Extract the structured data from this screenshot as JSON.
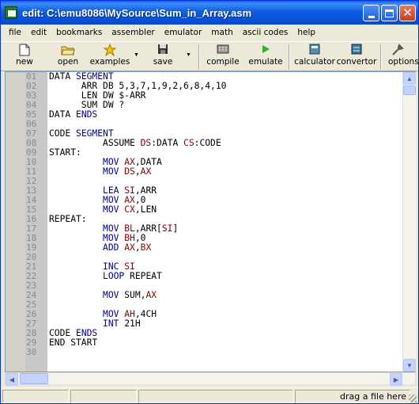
{
  "window": {
    "title": "edit: C:\\emu8086\\MySource\\Sum_in_Array.asm"
  },
  "menu": [
    "file",
    "edit",
    "bookmarks",
    "assembler",
    "emulator",
    "math",
    "ascii codes",
    "help"
  ],
  "toolbar": {
    "new": "new",
    "open": "open",
    "examples": "examples",
    "save": "save",
    "compile": "compile",
    "emulate": "emulate",
    "calculator": "calculator",
    "convertor": "convertor",
    "options": "options"
  },
  "icons": {
    "new": "new-file-icon",
    "open": "folder-open-icon",
    "examples": "star-icon",
    "save": "floppy-icon",
    "compile": "compile-icon",
    "emulate": "play-icon",
    "calculator": "calculator-icon",
    "convertor": "convertor-icon",
    "options": "tools-icon"
  },
  "editor": {
    "line_numbers": [
      "01",
      "02",
      "03",
      "04",
      "05",
      "06",
      "07",
      "08",
      "09",
      "10",
      "11",
      "12",
      "13",
      "14",
      "15",
      "16",
      "17",
      "18",
      "19",
      "20",
      "21",
      "22",
      "23",
      "24",
      "25",
      "26",
      "27",
      "28",
      "29",
      "30"
    ],
    "lines": [
      [
        {
          "t": "DATA "
        },
        {
          "t": "SEGMENT",
          "c": "kw"
        }
      ],
      [
        {
          "t": "      ARR DB 5,3,7,1,9,2,6,8,4,10"
        }
      ],
      [
        {
          "t": "      LEN DW $-ARR"
        }
      ],
      [
        {
          "t": "      SUM DW ?"
        }
      ],
      [
        {
          "t": "DATA "
        },
        {
          "t": "ENDS",
          "c": "kw"
        }
      ],
      [],
      [
        {
          "t": "CODE "
        },
        {
          "t": "SEGMENT",
          "c": "kw"
        }
      ],
      [
        {
          "t": "          ASSUME "
        },
        {
          "t": "DS",
          "c": "reg"
        },
        {
          "t": ":DATA "
        },
        {
          "t": "CS",
          "c": "reg"
        },
        {
          "t": ":CODE"
        }
      ],
      [
        {
          "t": "START:"
        }
      ],
      [
        {
          "t": "          "
        },
        {
          "t": "MOV",
          "c": "kw"
        },
        {
          "t": " "
        },
        {
          "t": "AX",
          "c": "reg"
        },
        {
          "t": ",DATA"
        }
      ],
      [
        {
          "t": "          "
        },
        {
          "t": "MOV",
          "c": "kw"
        },
        {
          "t": " "
        },
        {
          "t": "DS",
          "c": "reg"
        },
        {
          "t": ","
        },
        {
          "t": "AX",
          "c": "reg"
        }
      ],
      [],
      [
        {
          "t": "          "
        },
        {
          "t": "LEA",
          "c": "kw"
        },
        {
          "t": " "
        },
        {
          "t": "SI",
          "c": "reg"
        },
        {
          "t": ",ARR"
        }
      ],
      [
        {
          "t": "          "
        },
        {
          "t": "MOV",
          "c": "kw"
        },
        {
          "t": " "
        },
        {
          "t": "AX",
          "c": "reg"
        },
        {
          "t": ",0"
        }
      ],
      [
        {
          "t": "          "
        },
        {
          "t": "MOV",
          "c": "kw"
        },
        {
          "t": " "
        },
        {
          "t": "CX",
          "c": "reg"
        },
        {
          "t": ",LEN"
        }
      ],
      [
        {
          "t": "REPEAT:"
        }
      ],
      [
        {
          "t": "          "
        },
        {
          "t": "MOV",
          "c": "kw"
        },
        {
          "t": " "
        },
        {
          "t": "BL",
          "c": "reg"
        },
        {
          "t": ",ARR["
        },
        {
          "t": "SI",
          "c": "reg"
        },
        {
          "t": "]"
        }
      ],
      [
        {
          "t": "          "
        },
        {
          "t": "MOV",
          "c": "kw"
        },
        {
          "t": " "
        },
        {
          "t": "BH",
          "c": "reg"
        },
        {
          "t": ",0"
        }
      ],
      [
        {
          "t": "          "
        },
        {
          "t": "ADD",
          "c": "kw"
        },
        {
          "t": " "
        },
        {
          "t": "AX",
          "c": "reg"
        },
        {
          "t": ","
        },
        {
          "t": "BX",
          "c": "reg"
        }
      ],
      [],
      [
        {
          "t": "          "
        },
        {
          "t": "INC",
          "c": "kw"
        },
        {
          "t": " "
        },
        {
          "t": "SI",
          "c": "reg"
        }
      ],
      [
        {
          "t": "          "
        },
        {
          "t": "LOOP",
          "c": "kw"
        },
        {
          "t": " REPEAT"
        }
      ],
      [],
      [
        {
          "t": "          "
        },
        {
          "t": "MOV",
          "c": "kw"
        },
        {
          "t": " SUM,"
        },
        {
          "t": "AX",
          "c": "reg"
        }
      ],
      [],
      [
        {
          "t": "          "
        },
        {
          "t": "MOV",
          "c": "kw"
        },
        {
          "t": " "
        },
        {
          "t": "AH",
          "c": "reg"
        },
        {
          "t": ",4CH"
        }
      ],
      [
        {
          "t": "          "
        },
        {
          "t": "INT",
          "c": "kw"
        },
        {
          "t": " 21H"
        }
      ],
      [
        {
          "t": "CODE "
        },
        {
          "t": "ENDS",
          "c": "kw"
        }
      ],
      [
        {
          "t": "END START"
        }
      ],
      []
    ]
  },
  "status": {
    "hint": "drag a file here"
  }
}
